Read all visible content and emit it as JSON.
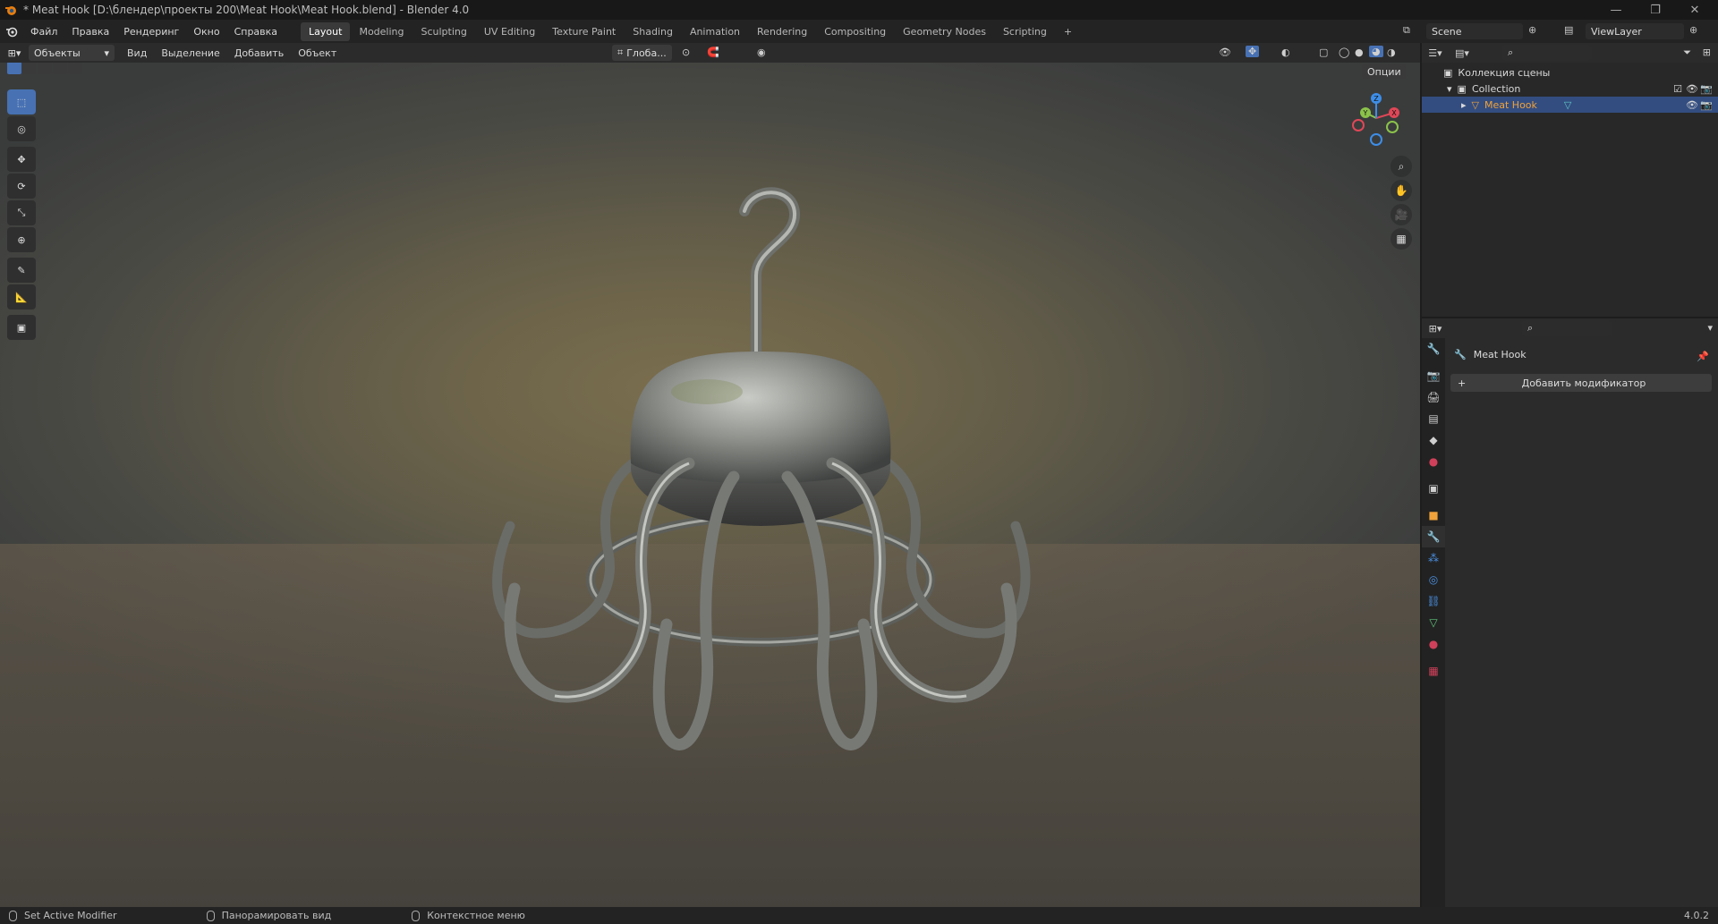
{
  "window": {
    "title": "* Meat Hook [D:\\блендер\\проекты 200\\Meat Hook\\Meat Hook.blend] - Blender 4.0",
    "controls": [
      "minimize-icon",
      "restore-icon",
      "close-icon"
    ]
  },
  "menu": {
    "items": [
      "Файл",
      "Правка",
      "Рендеринг",
      "Окно",
      "Справка"
    ]
  },
  "workspaces": {
    "tabs": [
      "Layout",
      "Modeling",
      "Sculpting",
      "UV Editing",
      "Texture Paint",
      "Shading",
      "Animation",
      "Rendering",
      "Compositing",
      "Geometry Nodes",
      "Scripting"
    ],
    "active": "Layout",
    "add": "+"
  },
  "scene": {
    "name": "Scene",
    "view_layer": "ViewLayer"
  },
  "viewport_header": {
    "mode": "Объекты",
    "menus": [
      "Вид",
      "Выделение",
      "Добавить",
      "Объект"
    ],
    "transform_orientation": "Глоба...",
    "options": "Опции"
  },
  "toolbar": {
    "tools": [
      "select-box-icon",
      "cursor-icon",
      "move-icon",
      "rotate-icon",
      "scale-icon",
      "transform-icon",
      "annotate-icon",
      "measure-icon",
      "add-cube-icon"
    ],
    "active": "select-box-icon"
  },
  "gizmo": {
    "x": "X",
    "y": "Y",
    "z": "Z"
  },
  "outliner": {
    "root": "Коллекция сцены",
    "collection": "Collection",
    "object": "Meat Hook"
  },
  "properties": {
    "object_name": "Meat Hook",
    "add_modifier": "Добавить модификатор",
    "active_tab": "wrench-icon"
  },
  "statusbar": {
    "left": "Set Active Modifier",
    "middle": "Панорамировать вид",
    "right": "Контекстное меню",
    "version": "4.0.2"
  },
  "colors": {
    "accent": "#4772b3",
    "selection": "#334d80",
    "object_label": "#f0a23a",
    "x_axis": "#e04757",
    "y_axis": "#8bc34a",
    "z_axis": "#3d8ee8"
  }
}
